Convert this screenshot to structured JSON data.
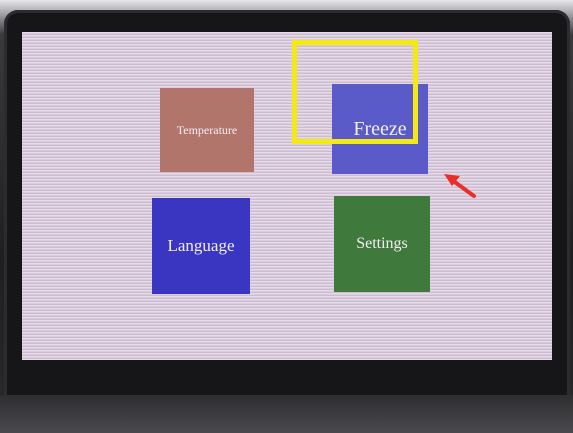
{
  "menu": {
    "tiles": [
      {
        "label": "Temperature",
        "color": "#b2756c"
      },
      {
        "label": "Freeze",
        "color": "#5a5ac8"
      },
      {
        "label": "Language",
        "color": "#3a36c2"
      },
      {
        "label": "Settings",
        "color": "#3f7a3c"
      }
    ]
  },
  "annotation": {
    "highlight_color": "#f2ea12",
    "arrow_color": "#e8302a",
    "highlighted_item": "Freeze",
    "arrow_icon": "arrow-pointer-icon"
  }
}
